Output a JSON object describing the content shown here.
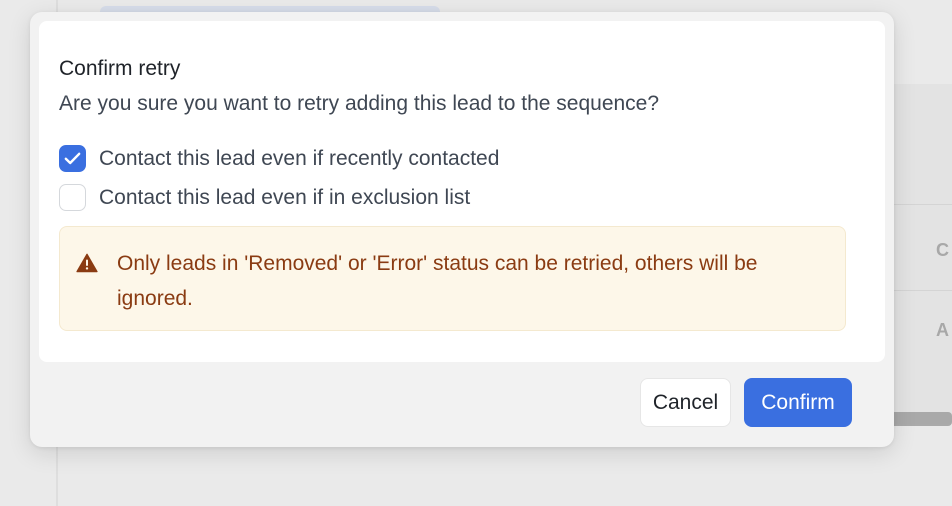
{
  "dialog": {
    "title": "Confirm retry",
    "message": "Are you sure you want to retry adding this lead to the sequence?",
    "options": [
      {
        "label": "Contact this lead even if recently contacted",
        "checked": true
      },
      {
        "label": "Contact this lead even if in exclusion list",
        "checked": false
      }
    ],
    "warning": {
      "icon": "warning-triangle-icon",
      "text": "Only leads in 'Removed' or 'Error' status can be retried, others will be ignored."
    },
    "buttons": {
      "cancel_label": "Cancel",
      "confirm_label": "Confirm"
    }
  },
  "background": {
    "panel_letters": [
      "C",
      "A"
    ]
  },
  "colors": {
    "accent": "#3a6fe0",
    "warning_bg": "#fdf7e9",
    "warning_text": "#8a3b12"
  }
}
